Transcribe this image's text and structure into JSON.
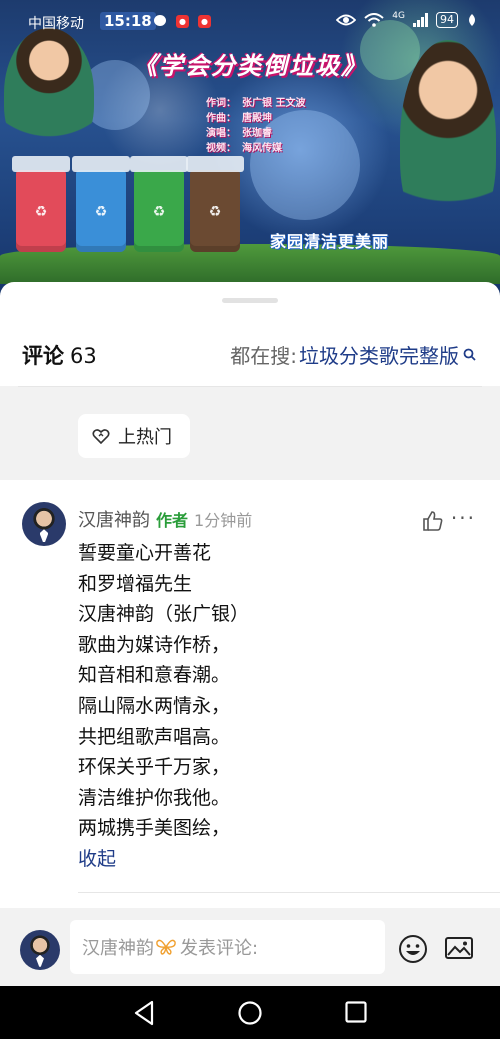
{
  "status_bar": {
    "carrier": "中国移动",
    "time": "15:18",
    "network": "4G",
    "battery": "94",
    "icons": [
      "chat-bubble-icon",
      "app-icon",
      "app-icon",
      "eye-icon",
      "wifi-icon",
      "signal-icon",
      "battery-icon",
      "leaf-icon"
    ]
  },
  "video": {
    "title": "《学会分类倒垃圾》",
    "credits": [
      {
        "role": "作词：",
        "name": "张广银 王文波"
      },
      {
        "role": "作曲：",
        "name": "唐殿坤"
      },
      {
        "role": "演唱：",
        "name": "张珈睿"
      },
      {
        "role": "视频：",
        "name": "海风传媒"
      }
    ],
    "slogan": "家园清洁更美丽",
    "bin_colors": [
      "#e24b5a",
      "#3a8fd8",
      "#3aa84a",
      "#6b4a32"
    ]
  },
  "comments_header": {
    "label": "评论",
    "count": "63",
    "search_prefix": "都在搜:",
    "search_keyword": "垃圾分类歌完整版"
  },
  "hot_button": {
    "label": "上热门"
  },
  "comment": {
    "author": "汉唐神韵",
    "badge": "作者",
    "time": "1分钟前",
    "lines": [
      "誓要童心开善花",
      "和罗增福先生",
      "汉唐神韵（张广银）",
      "歌曲为媒诗作桥，",
      "知音相和意春潮。",
      "隔山隔水两情永，",
      "共把组歌声唱高。",
      "环保关乎千万家，",
      "清洁维护你我他。",
      "两城携手美图绘，"
    ],
    "collapse_label": "收起"
  },
  "input_bar": {
    "username": "汉唐神韵",
    "placeholder": "发表评论:"
  },
  "colors": {
    "link": "#1f3c88",
    "author_badge": "#2a9d3a",
    "sheet_bg": "#ffffff",
    "gray_bg": "#f2f2f2"
  }
}
